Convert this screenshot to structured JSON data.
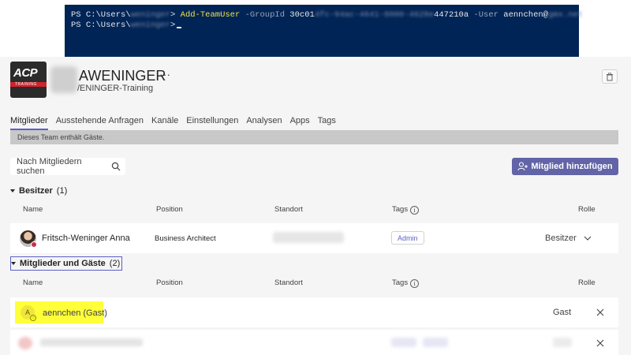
{
  "powershell": {
    "line1": {
      "prompt": "PS C:\\Users\\",
      "user_blur": "weninger",
      "prompt_end": "> ",
      "cmd": "Add-TeamUser",
      "p1": " -GroupId ",
      "gid_start": "30c01",
      "gid_blur": "4fc-94ac-4641-8000-4628e",
      "gid_end": "447210a",
      "p2": " -User ",
      "user_val": "aennchen@",
      "domain_blur": "gmx.net"
    },
    "line2": {
      "prompt": "PS C:\\Users\\",
      "user_blur": "weninger",
      "prompt_end": ">"
    }
  },
  "logo": {
    "text": "ACP",
    "sub": "TRAINING"
  },
  "team": {
    "name": "AWENINGER",
    "more": "···",
    "sub": "/ENINGER-Training"
  },
  "tabs": [
    "Mitglieder",
    "Ausstehende Anfragen",
    "Kanäle",
    "Einstellungen",
    "Analysen",
    "Apps",
    "Tags"
  ],
  "notice": "Dieses Team enthält Gäste.",
  "search": {
    "placeholder": "Nach Mitgliedern suchen"
  },
  "add_button": "Mitglied hinzufügen",
  "sections": {
    "owners": {
      "label": "Besitzer",
      "count": "(1)"
    },
    "members": {
      "label": "Mitglieder und Gäste",
      "count": "(2)"
    }
  },
  "columns": {
    "name": "Name",
    "position": "Position",
    "location": "Standort",
    "tags": "Tags",
    "role": "Rolle"
  },
  "owners": [
    {
      "name": "Fritsch-Weninger Anna",
      "position": "Business Architect",
      "tag": "Admin",
      "role": "Besitzer"
    }
  ],
  "members": [
    {
      "initial": "A",
      "name": "aennchen (Gast)",
      "role": "Gast"
    }
  ],
  "colors": {
    "accent": "#6264a7",
    "highlight": "#ffff3a",
    "ps_bg": "#012456"
  }
}
